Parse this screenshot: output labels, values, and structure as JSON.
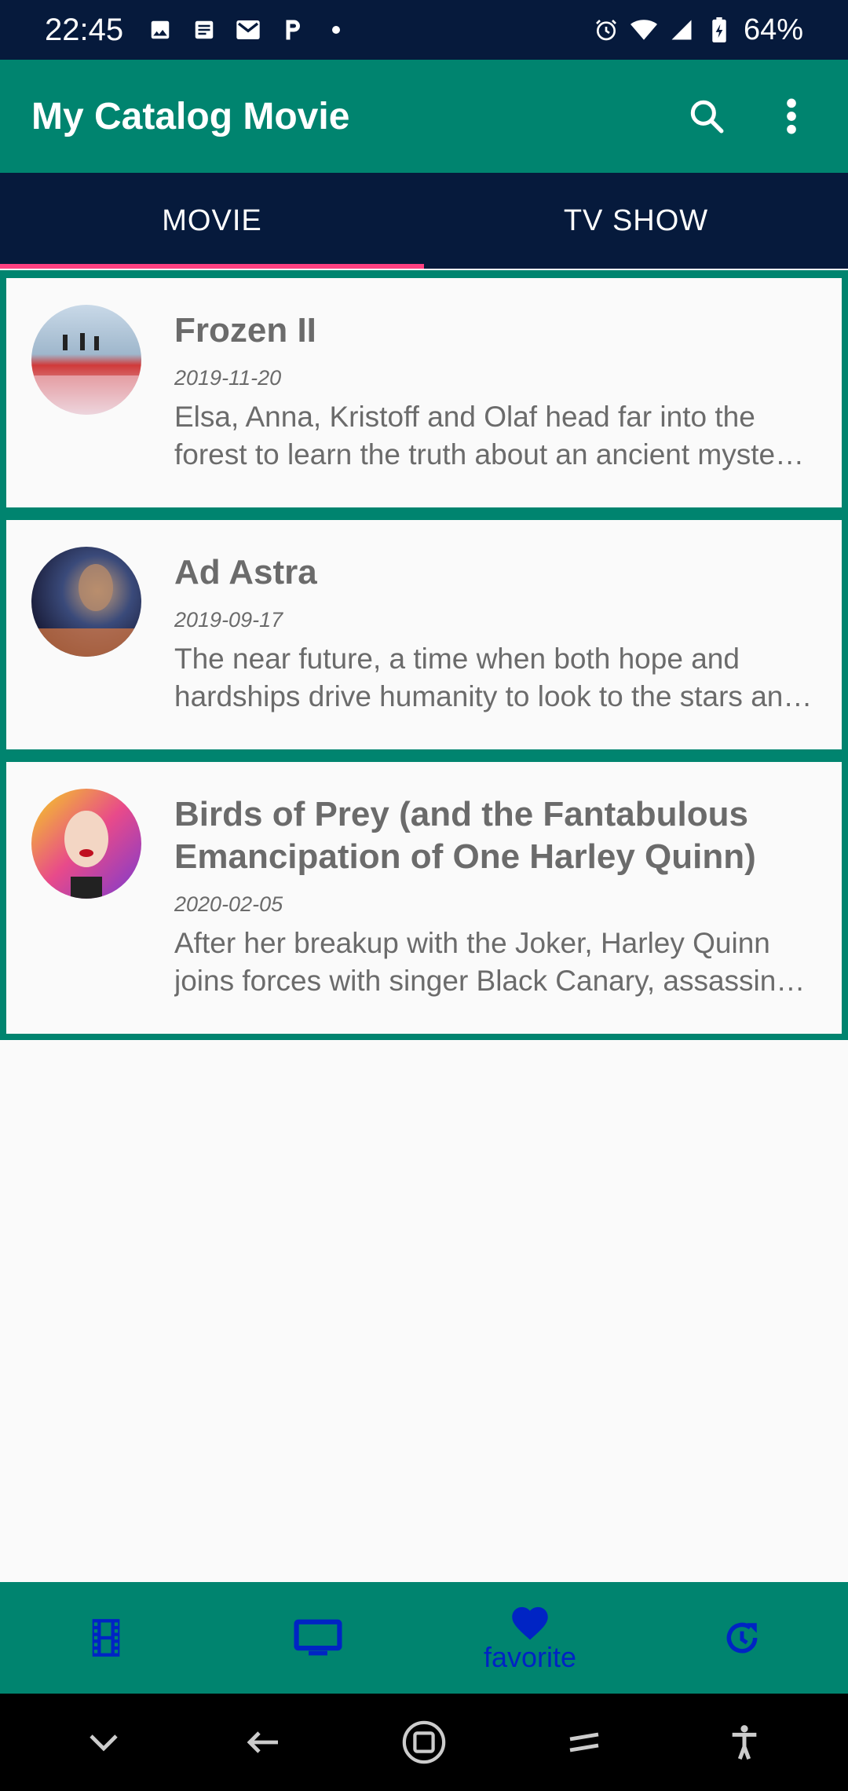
{
  "status_bar": {
    "time": "22:45",
    "battery": "64%",
    "icons": [
      "image-icon",
      "news-icon",
      "gmail-icon",
      "p-icon",
      "dot-icon",
      "alarm-icon",
      "wifi-icon",
      "signal-icon",
      "battery-icon"
    ]
  },
  "app_bar": {
    "title": "My Catalog Movie",
    "actions": [
      "search-icon",
      "more-vert-icon"
    ]
  },
  "tabs": [
    {
      "label": "MOVIE",
      "active": true
    },
    {
      "label": "TV SHOW",
      "active": false
    }
  ],
  "movies": [
    {
      "title": "Frozen II",
      "date": "2019-11-20",
      "overview": "Elsa, Anna, Kristoff and Olaf head far into the forest to learn the truth about an ancient mystery of their kingdom."
    },
    {
      "title": "Ad Astra",
      "date": "2019-09-17",
      "overview": "The near future, a time when both hope and hardships drive humanity to look to the stars and beyond."
    },
    {
      "title": "Birds of Prey (and the Fantabulous Emancipation of One Harley Quinn)",
      "date": "2020-02-05",
      "overview": "After her breakup with the Joker, Harley Quinn joins forces with singer Black Canary, assassin Huntress, and police detective Renee Montoya."
    }
  ],
  "bottom_nav": {
    "items": [
      {
        "icon": "film-icon",
        "label": ""
      },
      {
        "icon": "tv-icon",
        "label": ""
      },
      {
        "icon": "heart-icon",
        "label": "favorite"
      },
      {
        "icon": "reminder-icon",
        "label": ""
      }
    ]
  },
  "colors": {
    "primary": "#00846f",
    "dark": "#061a3c",
    "accent": "#ff4081",
    "nav_icon": "#0024c4",
    "text": "#6b6b6b"
  }
}
